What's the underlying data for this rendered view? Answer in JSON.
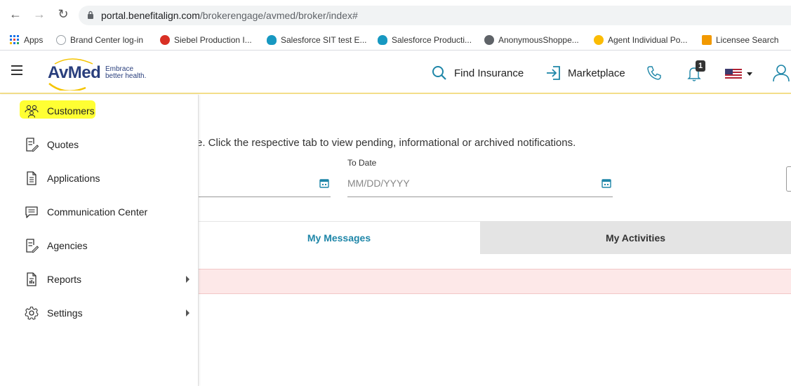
{
  "browser": {
    "url_host": "portal.benefitalign.com",
    "url_path": "/brokerengage/avmed/broker/index#",
    "bookmarks": [
      {
        "label": "Apps",
        "color": "#1a73e8"
      },
      {
        "label": "Brand Center log-in",
        "color": "#9aa0a6"
      },
      {
        "label": "Siebel Production I...",
        "color": "#d93025"
      },
      {
        "label": "Salesforce SIT test E...",
        "color": "#1798c1"
      },
      {
        "label": "Salesforce Producti...",
        "color": "#1798c1"
      },
      {
        "label": "AnonymousShoppe...",
        "color": "#5f6368"
      },
      {
        "label": "Agent Individual Po...",
        "color": "#fbbc04"
      },
      {
        "label": "Licensee Search",
        "color": "#f29900"
      }
    ]
  },
  "header": {
    "logo_text": "AvMed",
    "logo_tagline_1": "Embrace",
    "logo_tagline_2": "better health.",
    "find_insurance": "Find Insurance",
    "marketplace": "Marketplace",
    "notification_count": "1",
    "accent_color": "#1e86a8"
  },
  "main": {
    "info_text": "e. Click the respective tab to view pending, informational or archived notifications.",
    "to_date_label": "To Date",
    "to_date_placeholder": "MM/DD/YYYY",
    "tabs": [
      {
        "label": "My Messages",
        "active": true
      },
      {
        "label": "My Activities",
        "active": false
      }
    ]
  },
  "drawer": {
    "items": [
      {
        "label": "Customers",
        "icon": "people-icon",
        "highlighted": true,
        "submenu": false
      },
      {
        "label": "Quotes",
        "icon": "document-edit-icon",
        "submenu": false
      },
      {
        "label": "Applications",
        "icon": "document-icon",
        "submenu": false
      },
      {
        "label": "Communication Center",
        "icon": "chat-icon",
        "submenu": false
      },
      {
        "label": "Agencies",
        "icon": "document-edit-icon",
        "submenu": false
      },
      {
        "label": "Reports",
        "icon": "report-icon",
        "submenu": true
      },
      {
        "label": "Settings",
        "icon": "gear-icon",
        "submenu": true
      }
    ]
  }
}
